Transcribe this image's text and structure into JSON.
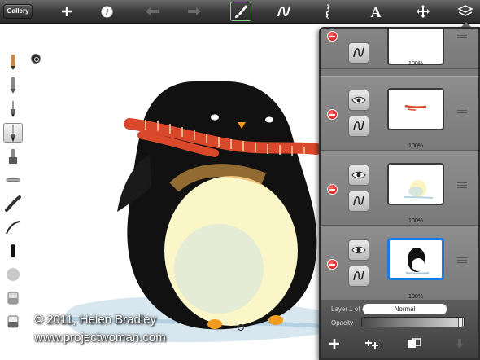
{
  "toolbar": {
    "gallery_label": "Gallery",
    "items": [
      "add-icon",
      "info-icon",
      "undo-icon",
      "redo-icon",
      "brush-icon",
      "stroke-icon",
      "symmetry-icon",
      "text-icon",
      "move-icon",
      "layers-icon"
    ],
    "active": "brush-icon"
  },
  "tools": [
    "pencil-icon",
    "ballpoint-icon",
    "marker-icon",
    "paintbrush-icon",
    "airbrush-icon",
    "chisel-icon",
    "smudge-icon",
    "line-icon",
    "pen-icon",
    "blur-icon",
    "eraser-icon",
    "fill-icon"
  ],
  "selected_tool": "paintbrush-icon",
  "watermark": {
    "line1": "© 2011, Helen Bradley",
    "line2": "www.projectwoman.com"
  },
  "layers_panel": {
    "layers": [
      {
        "opacity_label": "100%",
        "thumbnail": "blank",
        "selected": false
      },
      {
        "opacity_label": "100%",
        "thumbnail": "scarf",
        "selected": false
      },
      {
        "opacity_label": "100%",
        "thumbnail": "belly",
        "selected": false
      },
      {
        "opacity_label": "100%",
        "thumbnail": "penguin",
        "selected": true
      }
    ],
    "layer_count": "Layer 1 of 4",
    "blend_mode": "Normal",
    "opacity_label": "Opacity",
    "opacity_value": 1.0,
    "footer_icons": [
      "add-layer-icon",
      "duplicate-layer-icon",
      "merge-layer-icon",
      "move-down-icon"
    ]
  },
  "colors": {
    "toolbar": "#3a3a3a",
    "panel": "#4b4b4b",
    "selected_thumb": "#1e7ae0",
    "scarf": "#d9482b"
  }
}
